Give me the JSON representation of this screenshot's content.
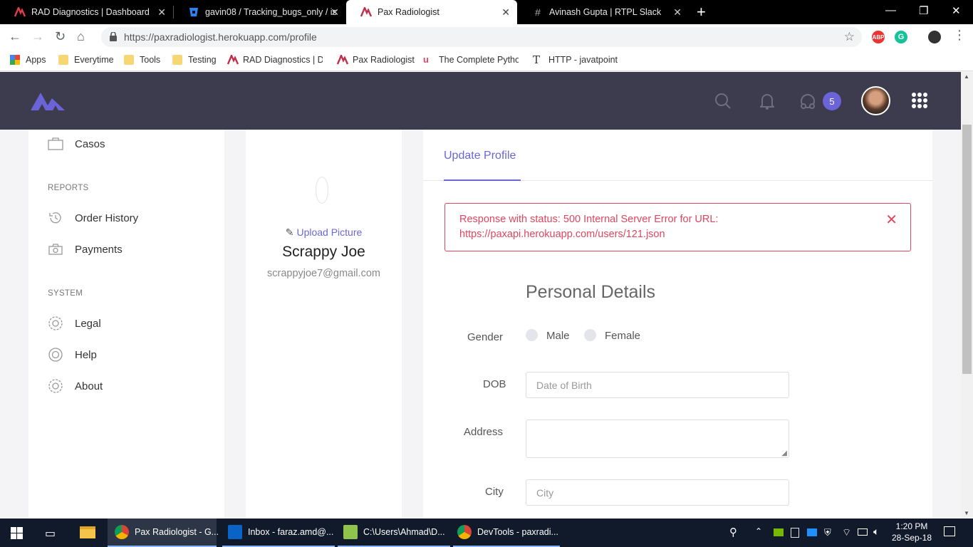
{
  "browser": {
    "tabs": [
      {
        "title": "RAD Diagnostics | Dashboard",
        "icon": "rad-logo-icon"
      },
      {
        "title": "gavin08 / Tracking_bugs_only / is",
        "icon": "bitbucket-icon"
      },
      {
        "title": "Pax Radiologist",
        "icon": "pax-logo-icon",
        "active": true
      },
      {
        "title": "Avinash Gupta | RTPL Slack",
        "icon": "slack-icon"
      }
    ],
    "url": "https://paxradiologist.herokuapp.com/profile",
    "bookmarks": [
      "Apps",
      "Everytime",
      "Tools",
      "Testing",
      "RAD Diagnostics | Da",
      "Pax Radiologist",
      "The Complete Pytho",
      "HTTP - javatpoint"
    ],
    "extensions": {
      "abp": "ABP",
      "grammarly": "G"
    }
  },
  "header": {
    "notification_count": "5"
  },
  "sidebar": {
    "top_item": "Casos",
    "sections": [
      {
        "heading": "REPORTS",
        "items": [
          "Order History",
          "Payments"
        ]
      },
      {
        "heading": "SYSTEM",
        "items": [
          "Legal",
          "Help",
          "About"
        ]
      }
    ]
  },
  "profile": {
    "upload_label": "Upload Picture",
    "name": "Scrappy Joe",
    "email": "scrappyjoe7@gmail.com"
  },
  "main": {
    "tab": "Update Profile",
    "alert": "Response with status: 500 Internal Server Error for URL: https://paxapi.herokuapp.com/users/121.json",
    "section_title": "Personal Details",
    "fields": {
      "gender_label": "Gender",
      "gender_options": [
        "Male",
        "Female"
      ],
      "dob_label": "DOB",
      "dob_placeholder": "Date of Birth",
      "address_label": "Address",
      "city_label": "City",
      "city_placeholder": "City"
    }
  },
  "taskbar": {
    "apps": [
      "Pax Radiologist - G...",
      "Inbox - faraz.amd@...",
      "C:\\Users\\Ahmad\\D...",
      "DevTools - paxradi..."
    ],
    "time": "1:20 PM",
    "date": "28-Sep-18"
  },
  "colors": {
    "accent": "#6b66d6",
    "header_bg": "#3d3c4e",
    "error": "#e0465e",
    "badge": "#6b63d8"
  }
}
